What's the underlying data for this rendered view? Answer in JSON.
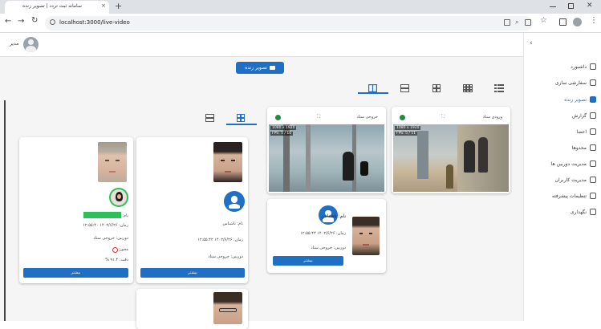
{
  "browser": {
    "tab_title": "سامانه ثبت تردد | تصویر زنده",
    "tab_close": "×",
    "new_tab": "+",
    "url": "localhost:3000/live-video"
  },
  "header": {
    "user_name": "مدیر",
    "live_button_label": "تصویر زنده"
  },
  "sidebar": {
    "collapse_icon": "chevron-left-icon",
    "items": [
      {
        "label": "داشبورد",
        "icon": "dashboard-icon",
        "active": false
      },
      {
        "label": "سفارشی سازی",
        "icon": "gear-icon",
        "active": false
      },
      {
        "label": "تصویر زنده",
        "icon": "camera-icon",
        "active": true
      },
      {
        "label": "گزارش",
        "icon": "report-icon",
        "active": false
      },
      {
        "label": "اعضا",
        "icon": "members-icon",
        "active": false
      },
      {
        "label": "محدوها",
        "icon": "zones-icon",
        "active": false
      },
      {
        "label": "مدیریت دوربین ها",
        "icon": "camera-manage-icon",
        "active": false
      },
      {
        "label": "مدیریت کاربران",
        "icon": "users-icon",
        "active": false
      },
      {
        "label": "تنظیمات پیشرفته",
        "icon": "settings-icon",
        "active": false
      },
      {
        "label": "نگهداری",
        "icon": "tools-icon",
        "active": false
      }
    ]
  },
  "cameras": [
    {
      "name": "ورودی ستاد",
      "resolution": "1080 x 1920",
      "fps": "FPS: 5 / 11",
      "status_color": "#1e8e3e"
    },
    {
      "name": "خروجی ستاد",
      "resolution": "1080 x 1920",
      "fps": "FPS: 5 / 10",
      "status_color": "#1e8e3e"
    }
  ],
  "detection_card": {
    "name_label": "نام: ناشناس",
    "time_label": "زمان: ۱۴۰۲/۶/۲۶ ۱۲:۵۵:۴۳",
    "camera_label": "دوربین: خروجی ستاد",
    "more_button": "بیشتر"
  },
  "event_cards": [
    {
      "name_label": "نام: ناشناس",
      "time_label": "زمان: ۱۴۰۲/۶/۲۶ ۱۲:۵۵:۴۲",
      "camera_label": "دوربین: خروجی ستاد",
      "more_button": "بیشتر"
    },
    {
      "name_label": "نام:",
      "time_label": "زمان: ۱۴۰۲/۶/۲۶ ۱۲:۵۵:۴۰",
      "camera_label": "دوربین: خروجی ستاد",
      "permit_label": "مجوز:",
      "match_label": "دقت: ۹۱.۴ %",
      "more_button": "بیشتر"
    }
  ],
  "colors": {
    "accent": "#1f6fc5",
    "match_bar": "#2dbf5a",
    "denied": "#e03131"
  }
}
